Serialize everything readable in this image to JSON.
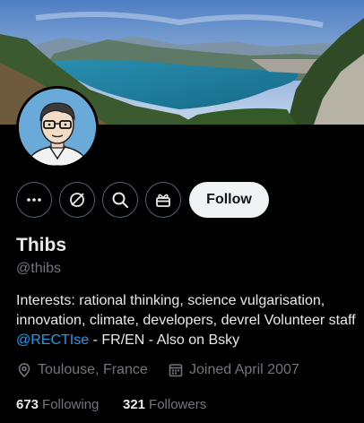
{
  "profile": {
    "name": "Thibs",
    "handle": "@thibs",
    "bio": {
      "text_before": "Interests: rational thinking, science vulgarisation, innovation, climate, developers, devrel Volunteer staff ",
      "mention": "@RECTIse",
      "text_after": " - FR/EN - Also on Bsky"
    },
    "location": "Toulouse, France",
    "joined": "Joined April 2007",
    "following_count": "673",
    "following_label": "Following",
    "followers_count": "321",
    "followers_label": "Followers"
  },
  "actions": {
    "more_icon": "more-icon",
    "grok_icon": "grok-icon",
    "search_icon": "search-icon",
    "subscribe_icon": "gift-icon",
    "follow_label": "Follow"
  },
  "icons": {
    "location": "location-pin-icon",
    "joined": "calendar-icon"
  },
  "colors": {
    "background": "#000000",
    "accent": "#1d9bf0",
    "text_primary": "#e7e9ea",
    "text_secondary": "#71767b",
    "button_bg": "#eff3f4"
  }
}
